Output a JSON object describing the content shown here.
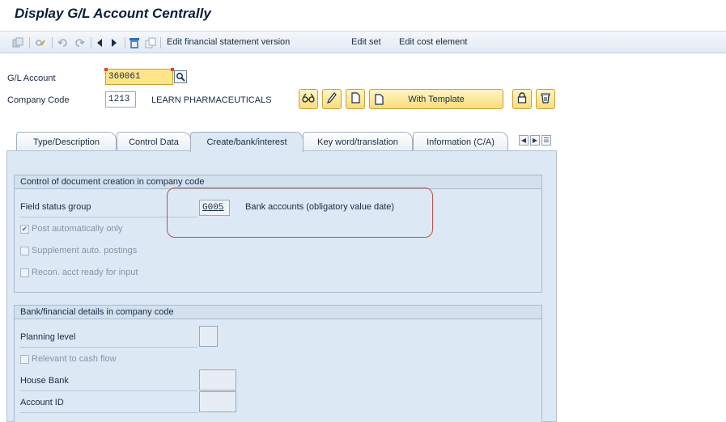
{
  "title": "Display G/L Account Centrally",
  "toolbar": {
    "edit_fs_version": "Edit financial statement version",
    "edit_set": "Edit set",
    "edit_cost_element": "Edit cost element"
  },
  "header": {
    "gl_account_label": "G/L Account",
    "gl_account_value": "360061",
    "company_code_label": "Company Code",
    "company_code_value": "1213",
    "company_name": "LEARN PHARMACEUTICALS",
    "with_template_label": "With Template"
  },
  "tabs": [
    {
      "label": "Type/Description"
    },
    {
      "label": "Control Data"
    },
    {
      "label": "Create/bank/interest"
    },
    {
      "label": "Key word/translation"
    },
    {
      "label": "Information (C/A)"
    }
  ],
  "group_document": {
    "title": "Control of document creation in company code",
    "field_status_group_label": "Field status group",
    "field_status_group_value": "G005",
    "field_status_group_desc": "Bank accounts (obligatory value date)",
    "post_auto_only": "Post automatically only",
    "post_auto_only_checked": true,
    "supplement_auto": "Supplement auto. postings",
    "recon_ready": "Recon. acct ready for input"
  },
  "group_bank": {
    "title": "Bank/financial details in company code",
    "planning_level_label": "Planning level",
    "relevant_cash_flow": "Relevant to cash flow",
    "house_bank_label": "House Bank",
    "account_id_label": "Account ID"
  },
  "icons": [
    "switch-icon",
    "display-change-icon",
    "undo-icon",
    "redo-icon",
    "previous-icon",
    "next-icon",
    "filter-icon",
    "copy-icon",
    "search-help-icon",
    "glasses-icon",
    "pencil-icon",
    "create-icon",
    "lock-icon",
    "trash-icon",
    "check-icon"
  ]
}
